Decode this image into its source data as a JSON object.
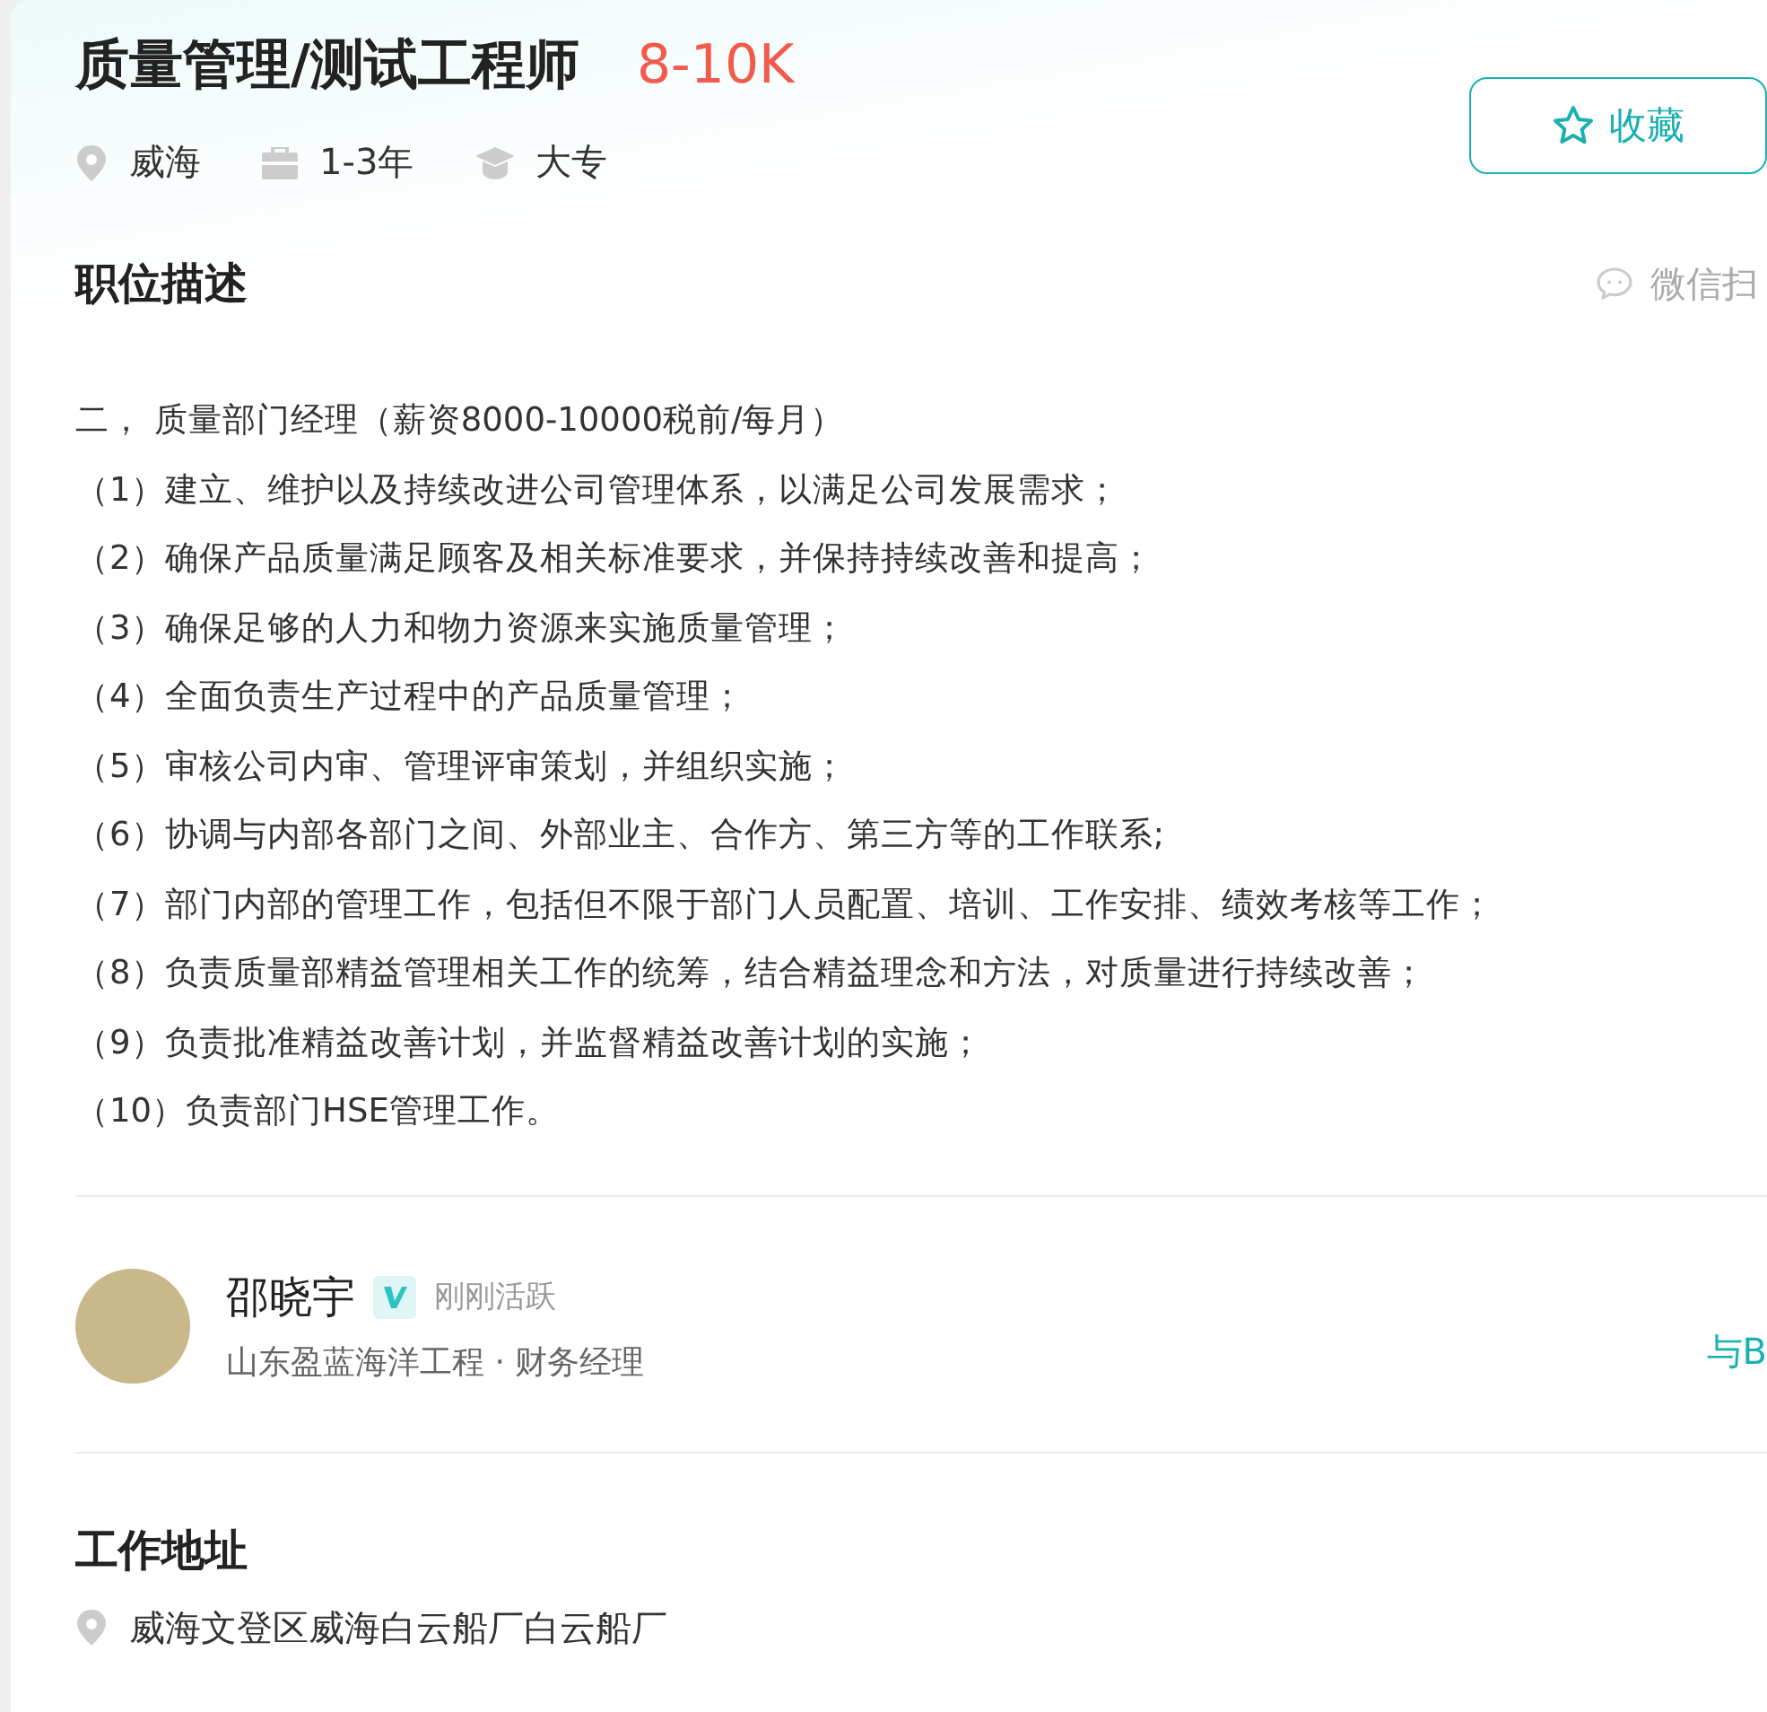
{
  "job": {
    "title": "质量管理/测试工程师",
    "salary": "8-10K",
    "meta": [
      {
        "kind": "location",
        "text": "威海"
      },
      {
        "kind": "experience",
        "text": "1-3年"
      },
      {
        "kind": "education",
        "text": "大专"
      }
    ],
    "collect_button": "收藏"
  },
  "description": {
    "heading": "职位描述",
    "wechat_hint": "微信扫",
    "lines": [
      "二， 质量部门经理（薪资8000-10000税前/每月）",
      "（1）建立、维护以及持续改进公司管理体系，以满足公司发展需求；",
      "（2）确保产品质量满足顾客及相关标准要求，并保持持续改善和提高；",
      "（3）确保足够的人力和物力资源来实施质量管理；",
      "（4）全面负责生产过程中的产品质量管理；",
      "（5）审核公司内审、管理评审策划，并组织实施；",
      "（6）协调与内部各部门之间、外部业主、合作方、第三方等的工作联系;",
      "（7）部门内部的管理工作，包括但不限于部门人员配置、培训、工作安排、绩效考核等工作；",
      "（8）负责质量部精益管理相关工作的统筹，结合精益理念和方法，对质量进行持续改善；",
      "（9）负责批准精益改善计划，并监督精益改善计划的实施；",
      "（10）负责部门HSE管理工作。"
    ]
  },
  "recruiter": {
    "name": "邵晓宇",
    "status": "刚刚活跃",
    "company_role": "山东盈蓝海洋工程 · 财务经理",
    "chat_link": "与B"
  },
  "address": {
    "heading": "工作地址",
    "text": "威海文登区威海白云船厂白云船厂"
  }
}
